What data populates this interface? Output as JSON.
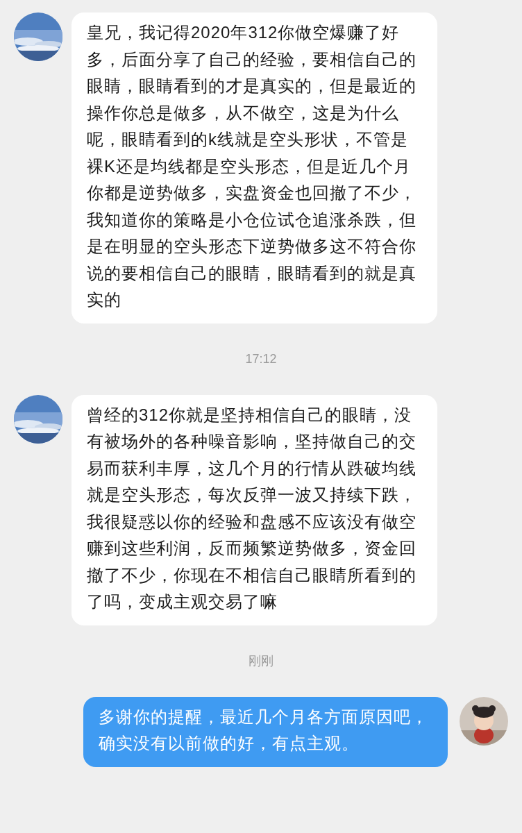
{
  "messages": [
    {
      "kind": "incoming",
      "text": "皇兄，我记得2020年312你做空爆赚了好多，后面分享了自己的经验，要相信自己的眼睛，眼睛看到的才是真实的，但是最近的操作你总是做多，从不做空，这是为什么呢，眼睛看到的k线就是空头形状，不管是裸K还是均线都是空头形态，但是近几个月你都是逆势做多，实盘资金也回撤了不少，我知道你的策略是小仓位试仓追涨杀跌，但是在明显的空头形态下逆势做多这不符合你说的要相信自己的眼睛，眼睛看到的就是真实的"
    },
    {
      "kind": "timestamp",
      "text": "17:12"
    },
    {
      "kind": "incoming",
      "text": "曾经的312你就是坚持相信自己的眼睛，没有被场外的各种噪音影响，坚持做自己的交易而获利丰厚，这几个月的行情从跌破均线就是空头形态，每次反弹一波又持续下跌，我很疑惑以你的经验和盘感不应该没有做空赚到这些利润，反而频繁逆势做多，资金回撤了不少，你现在不相信自己眼睛所看到的了吗，变成主观交易了嘛"
    },
    {
      "kind": "timestamp",
      "text": "刚刚"
    },
    {
      "kind": "outgoing",
      "text": "多谢你的提醒，最近几个月各方面原因吧，确实没有以前做的好，有点主观。"
    }
  ]
}
